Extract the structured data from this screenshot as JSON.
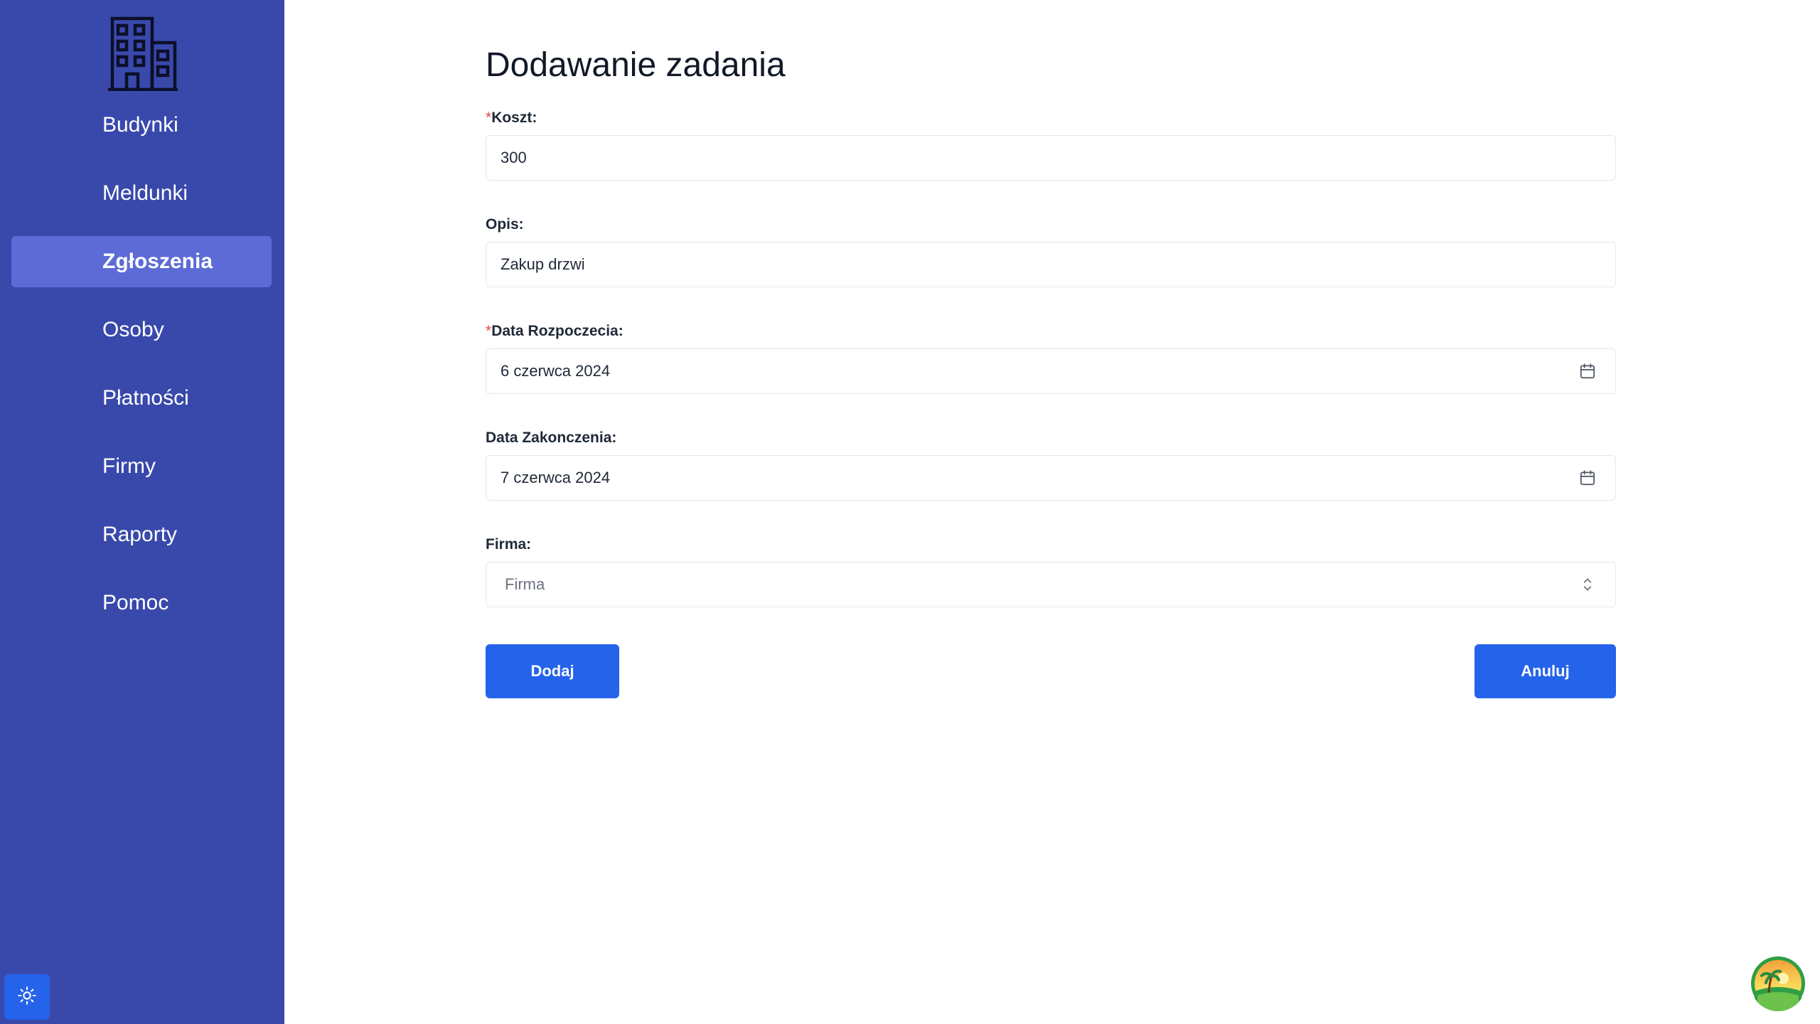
{
  "sidebar": {
    "logo_icon": "building-icon",
    "items": [
      {
        "label": "Budynki",
        "active": false
      },
      {
        "label": "Meldunki",
        "active": false
      },
      {
        "label": "Zgłoszenia",
        "active": true
      },
      {
        "label": "Osoby",
        "active": false
      },
      {
        "label": "Płatności",
        "active": false
      },
      {
        "label": "Firmy",
        "active": false
      },
      {
        "label": "Raporty",
        "active": false
      },
      {
        "label": "Pomoc",
        "active": false
      }
    ],
    "theme_toggle_icon": "sun-icon"
  },
  "form": {
    "title": "Dodawanie zadania",
    "required_mark": "*",
    "fields": {
      "cost": {
        "label": "Koszt:",
        "value": "300"
      },
      "description": {
        "label": "Opis:",
        "value": "Zakup drzwi"
      },
      "start_date": {
        "label": "Data Rozpoczecia:",
        "value": "6 czerwca 2024",
        "icon": "calendar-icon"
      },
      "end_date": {
        "label": "Data Zakonczenia:",
        "value": "7 czerwca 2024",
        "icon": "calendar-icon"
      },
      "company": {
        "label": "Firma:",
        "placeholder": "Firma",
        "icon": "chevron-up-down-icon"
      }
    },
    "add_label": "Dodaj",
    "cancel_label": "Anuluj"
  },
  "colors": {
    "sidebar_bg": "#3949ab",
    "sidebar_active": "#5c6bd6",
    "primary": "#2563eb",
    "required": "#ef4444"
  }
}
